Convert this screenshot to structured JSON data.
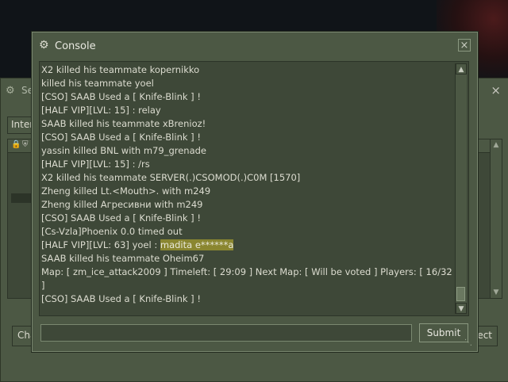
{
  "background_window": {
    "title": "Se",
    "tab_label": "Inter",
    "close_glyph": "×",
    "left_button_label": "Cha",
    "right_button_label": "ect",
    "header_icons": [
      "lock-icon",
      "shield-icon"
    ]
  },
  "console": {
    "title": "Console",
    "close_glyph": "×",
    "lines": [
      "X2 killed his teammate kopernikko",
      " killed his teammate yoel",
      "[CSO] SAAB Used a [ Knife-Blink ] !",
      "[HALF VIP][LVL: 15]  : relay",
      "SAAB killed his teammate xBrenioz!",
      "[CSO] SAAB Used a [ Knife-Blink ] !",
      "yassin killed BNL with m79_grenade",
      "[HALF VIP][LVL: 15]  : /rs",
      "X2 killed his teammate SERVER(.)CSOMOD(.)C0M [1570]",
      "Zheng killed Lt.<Mouth>. with m249",
      "Zheng killed Агресивни with m249",
      "[CSO] SAAB Used a [ Knife-Blink ] !",
      "[Cs-Vzla]Phoenix 0.0 timed out"
    ],
    "highlight_line": {
      "prefix": "[HALF VIP][LVL: 63] yoel : ",
      "highlighted": "madita e******a"
    },
    "lines_after": [
      "SAAB killed his teammate Oheim67",
      "Map: [ zm_ice_attack2009 ] Timeleft: [ 29:09 ] Next Map: [ Will be voted ] Players: [ 16/32 ]",
      "[CSO] SAAB Used a [ Knife-Blink ] !"
    ],
    "input_value": "",
    "submit_label": "Submit"
  }
}
